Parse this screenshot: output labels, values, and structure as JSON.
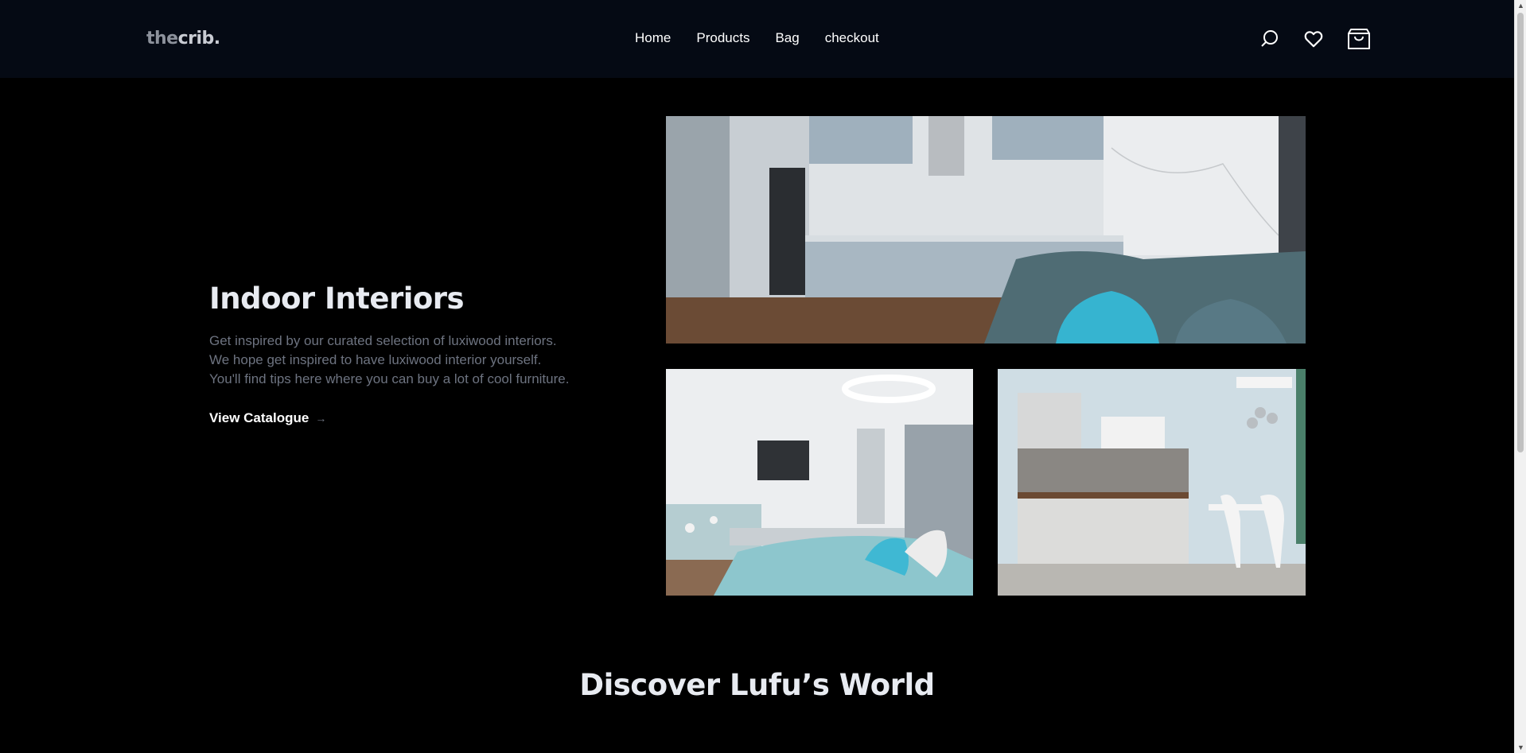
{
  "brand": {
    "logo_prefix": "the",
    "logo_suffix": "crib."
  },
  "nav": {
    "items": [
      {
        "label": "Home"
      },
      {
        "label": "Products"
      },
      {
        "label": "Bag"
      },
      {
        "label": "checkout"
      }
    ]
  },
  "header_icons": [
    "search-icon",
    "heart-icon",
    "shopping-bag-icon"
  ],
  "hero": {
    "title": "Indoor Interiors",
    "description_lines": [
      "Get inspired by our curated selection of luxiwood interiors.",
      "We hope get inspired to have luxiwood interior yourself.",
      "You'll find tips here where you can buy a lot of cool furniture."
    ],
    "cta_label": "View Catalogue",
    "cta_arrow": "→"
  },
  "section": {
    "title": "Discover Lufu’s World"
  },
  "colors": {
    "header_bg": "#050a14",
    "page_bg": "#000000",
    "muted_text": "#6d7380",
    "heading_text": "#e8ebf1"
  }
}
